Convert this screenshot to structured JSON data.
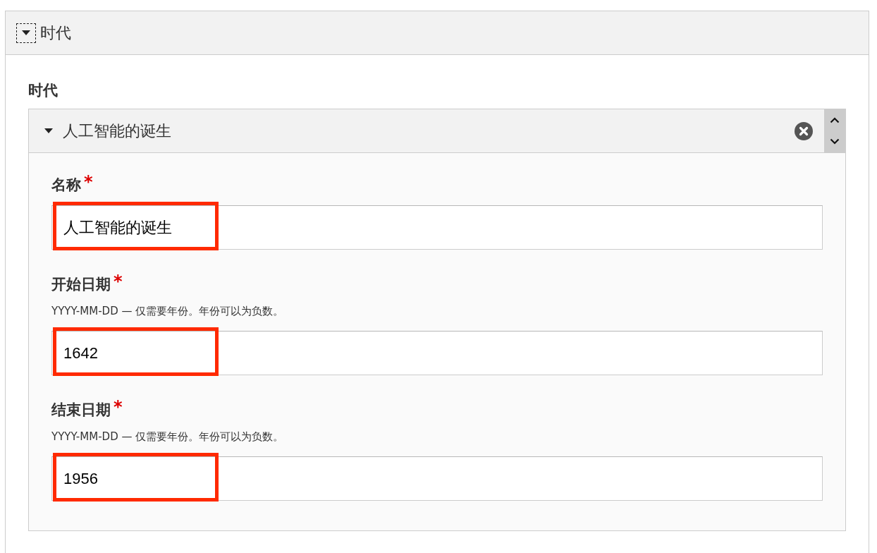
{
  "panel": {
    "title": "时代",
    "expanded": true
  },
  "section_label": "时代",
  "item": {
    "title": "人工智能的诞生",
    "expanded": true
  },
  "fields": [
    {
      "label": "名称",
      "required_mark": "*",
      "value": "人工智能的诞生",
      "highlighted": true
    },
    {
      "label": "开始日期",
      "required_mark": "*",
      "description": "YYYY-MM-DD — 仅需要年份。年份可以为负数。",
      "value": "1642",
      "highlighted": true
    },
    {
      "label": "结束日期",
      "required_mark": "*",
      "description": "YYYY-MM-DD — 仅需要年份。年份可以为负数。",
      "value": "1956",
      "highlighted": true
    }
  ]
}
